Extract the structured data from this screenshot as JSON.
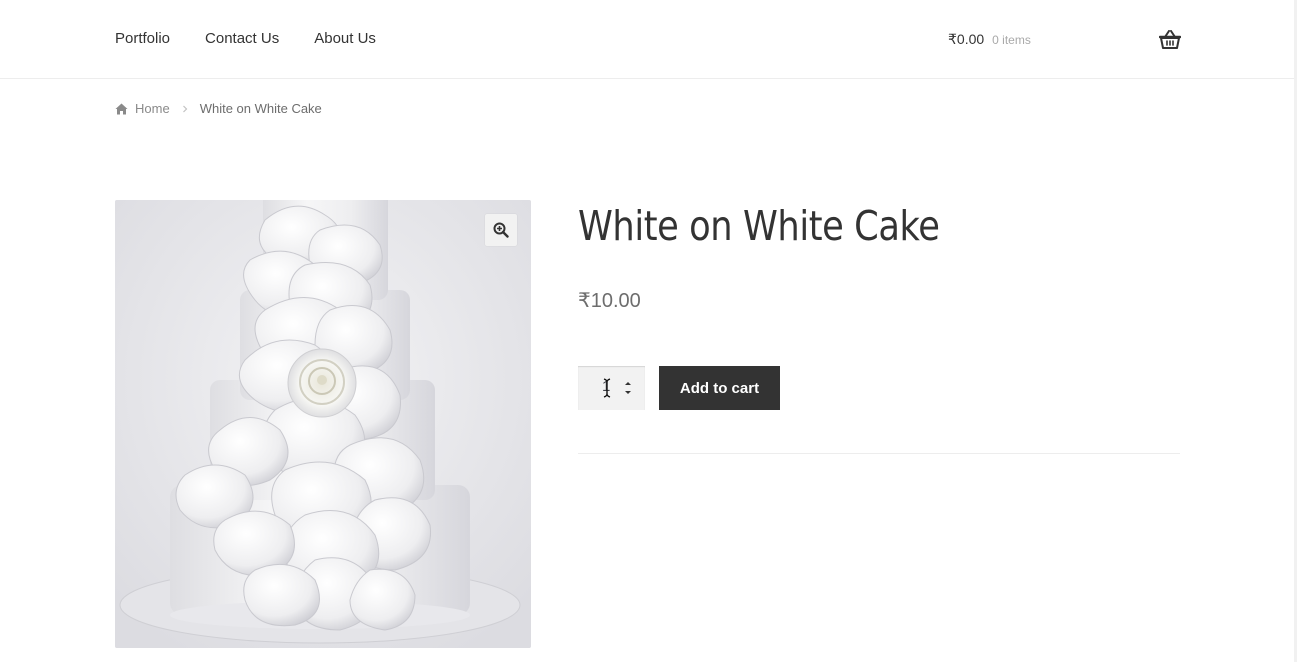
{
  "header": {
    "nav": [
      {
        "label": "Portfolio"
      },
      {
        "label": "Contact Us"
      },
      {
        "label": "About Us"
      }
    ],
    "cart": {
      "amount": "₹0.00",
      "count": "0 items",
      "icon": "basket-icon"
    }
  },
  "breadcrumb": {
    "home_icon": "home-icon",
    "home_label": "Home",
    "current": "White on White Cake"
  },
  "product": {
    "title": "White on White Cake",
    "price": "₹10.00",
    "quantity": "1",
    "add_to_cart_label": "Add to cart",
    "zoom_icon": "zoom-in-icon",
    "image_alt": "White on White Cake"
  }
}
